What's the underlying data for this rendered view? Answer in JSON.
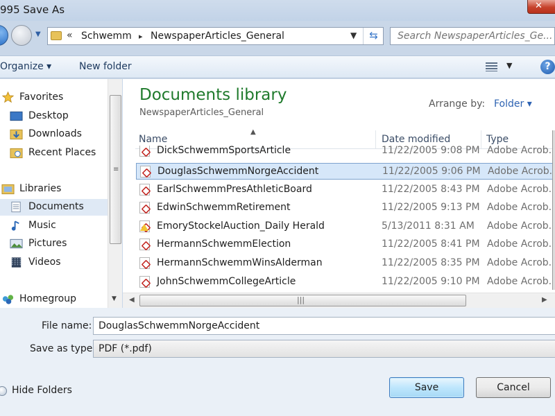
{
  "window": {
    "title": "995 Save As"
  },
  "address": {
    "overflow": "«",
    "segments": [
      "Schwemm",
      "NewspaperArticles_General"
    ],
    "separator": "▸"
  },
  "search": {
    "placeholder": "Search NewspaperArticles_Ge..."
  },
  "toolbar": {
    "organize": "Organize ▾",
    "new_folder": "New folder",
    "help": "?"
  },
  "nav": {
    "favorites": "Favorites",
    "favorite_items": [
      "Desktop",
      "Downloads",
      "Recent Places"
    ],
    "libraries": "Libraries",
    "library_items": [
      "Documents",
      "Music",
      "Pictures",
      "Videos"
    ],
    "homegroup": "Homegroup"
  },
  "library": {
    "title": "Documents library",
    "subtitle": "NewspaperArticles_General",
    "arrange_label": "Arrange by:",
    "arrange_value": "Folder ▾"
  },
  "columns": {
    "name": "Name",
    "date": "Date modified",
    "type": "Type"
  },
  "files": [
    {
      "name": "DickSchwemmSportsArticle",
      "date": "11/22/2005 9:08 PM",
      "type": "Adobe Acrob..."
    },
    {
      "name": "DouglasSchwemmNorgeAccident",
      "date": "11/22/2005 9:06 PM",
      "type": "Adobe Acrob..."
    },
    {
      "name": "EarlSchwemmPresAthleticBoard",
      "date": "11/22/2005 8:43 PM",
      "type": "Adobe Acrob..."
    },
    {
      "name": "EdwinSchwemmRetirement",
      "date": "11/22/2005 9:13 PM",
      "type": "Adobe Acrob..."
    },
    {
      "name": "EmoryStockelAuction_Daily Herald",
      "date": "5/13/2011 8:31 AM",
      "type": "Adobe Acrob..."
    },
    {
      "name": "HermannSchwemmElection",
      "date": "11/22/2005 8:41 PM",
      "type": "Adobe Acrob..."
    },
    {
      "name": "HermannSchwemmWinsAlderman",
      "date": "11/22/2005 8:35 PM",
      "type": "Adobe Acrob..."
    },
    {
      "name": "JohnSchwemmCollegeArticle",
      "date": "11/22/2005 9:10 PM",
      "type": "Adobe Acrob..."
    }
  ],
  "form": {
    "file_name_label": "File name:",
    "file_name_value": "DouglasSchwemmNorgeAccident",
    "save_type_label": "Save as type:",
    "save_type_value": "PDF (*.pdf)"
  },
  "footer": {
    "hide_folders": "Hide Folders",
    "save": "Save",
    "cancel": "Cancel"
  },
  "colors": {
    "library_title": "#1f7a2c",
    "link_blue": "#2d62b2",
    "selection": "#d6e7f9"
  }
}
